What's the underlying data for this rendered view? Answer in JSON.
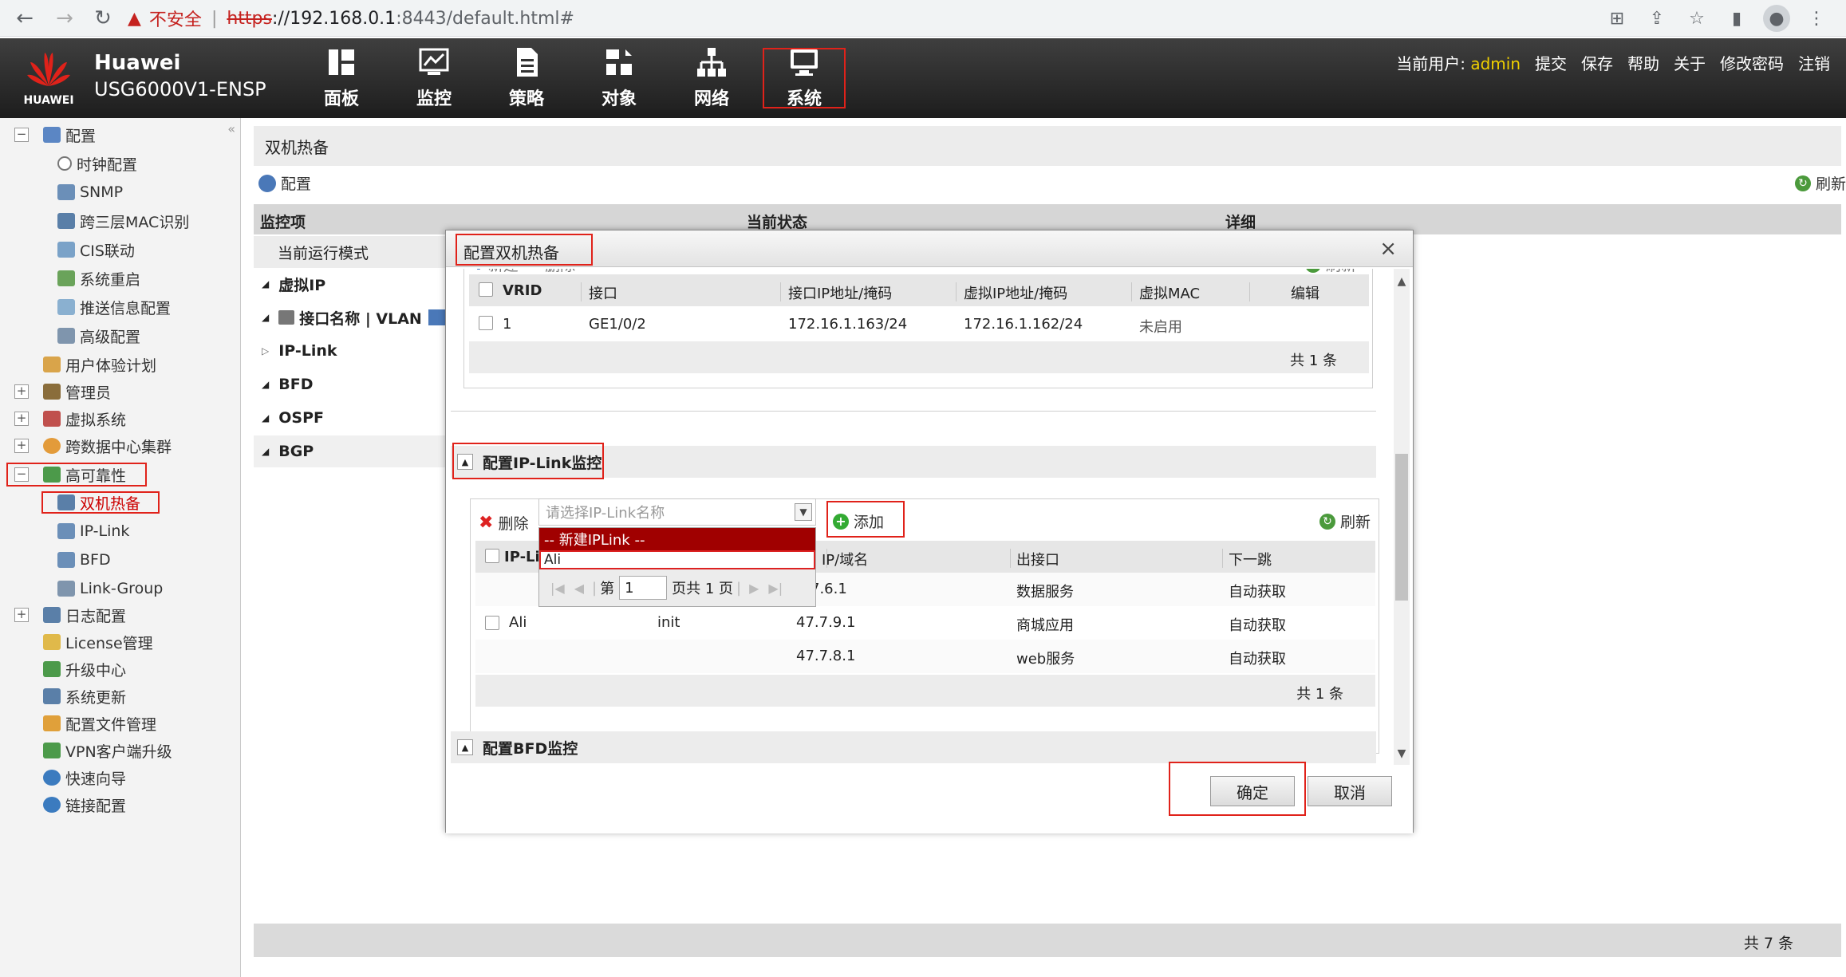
{
  "browser": {
    "insecure_label": "不安全",
    "url_proto": "https",
    "url_host": "://192.168.0.1",
    "url_rest": ":8443/default.html#"
  },
  "header": {
    "logo_text": "HUAWEI",
    "brand_name": "Huawei",
    "brand_model": "USG6000V1-ENSP",
    "nav": [
      {
        "label": "面板",
        "icon": "dashboard-icon"
      },
      {
        "label": "监控",
        "icon": "monitor-icon"
      },
      {
        "label": "策略",
        "icon": "policy-icon"
      },
      {
        "label": "对象",
        "icon": "object-icon"
      },
      {
        "label": "网络",
        "icon": "network-icon"
      },
      {
        "label": "系统",
        "icon": "system-icon"
      }
    ],
    "active_nav": "系统",
    "current_user_label": "当前用户:",
    "current_user": "admin",
    "links": [
      "提交",
      "保存",
      "帮助",
      "关于",
      "修改密码",
      "注销"
    ]
  },
  "sidebar": {
    "config_root": "配置",
    "config_children": [
      "时钟配置",
      "SNMP",
      "跨三层MAC识别",
      "CIS联动",
      "系统重启",
      "推送信息配置",
      "高级配置"
    ],
    "user_experience": "用户体验计划",
    "admin": "管理员",
    "virtual_system": "虚拟系统",
    "cross_dc": "跨数据中心集群",
    "ha": "高可靠性",
    "ha_children": [
      "双机热备",
      "IP-Link",
      "BFD",
      "Link-Group"
    ],
    "log_config": "日志配置",
    "license": "License管理",
    "upgrade_center": "升级中心",
    "system_update": "系统更新",
    "config_file": "配置文件管理",
    "vpn_upgrade": "VPN客户端升级",
    "quick_wizard": "快速向导",
    "link_config": "链接配置"
  },
  "content": {
    "title": "双机热备",
    "config_link": "配置",
    "refresh": "刷新",
    "columns": [
      "监控项",
      "当前状态",
      "详细"
    ],
    "row_mode": "当前运行模式",
    "groups": [
      "虚拟IP",
      "接口名称 | VLAN",
      "IP-Link",
      "BFD",
      "OSPF",
      "BGP"
    ],
    "footer_total": "共 7 条"
  },
  "modal": {
    "title": "配置双机热备",
    "vrrp": {
      "new_label": "新建",
      "delete_label": "删除",
      "refresh_label": "刷新",
      "columns": [
        "VRID",
        "接口",
        "接口IP地址/掩码",
        "虚拟IP地址/掩码",
        "虚拟MAC",
        "编辑"
      ],
      "rows": [
        {
          "vrid": "1",
          "interface": "GE1/0/2",
          "ip_mask": "172.16.1.163/24",
          "vip_mask": "172.16.1.162/24",
          "vmac": "未启用"
        }
      ],
      "total": "共 1 条"
    },
    "iplink": {
      "section_title": "配置IP-Link监控",
      "delete_label": "删除",
      "combo_placeholder": "请选择IP-Link名称",
      "add_label": "添加",
      "refresh_label": "刷新",
      "col_name": "IP-Li",
      "col_ip": "IP/域名",
      "col_out": "出接口",
      "col_next": "下一跳",
      "row_name": "Ali",
      "row_state": "init",
      "ips": [
        "47.7.6.1",
        "47.7.9.1",
        "47.7.8.1"
      ],
      "ip_visible": [
        "7.6.1",
        "47.7.9.1",
        "47.7.8.1"
      ],
      "outs": [
        "数据服务",
        "商城应用",
        "web服务"
      ],
      "nexts": [
        "自动获取",
        "自动获取",
        "自动获取"
      ],
      "total": "共 1 条",
      "dropdown_new": "-- 新建IPLink --",
      "dropdown_ali": "Ali",
      "pager_prefix": "第",
      "pager_page": "1",
      "pager_suffix": "页共 1 页"
    },
    "bfd_section_title": "配置BFD监控",
    "ok_label": "确定",
    "cancel_label": "取消"
  },
  "colors": {
    "highlight_red": "#e0221a",
    "dropdown_selected": "#a00000",
    "admin_yellow": "#f0d000"
  }
}
